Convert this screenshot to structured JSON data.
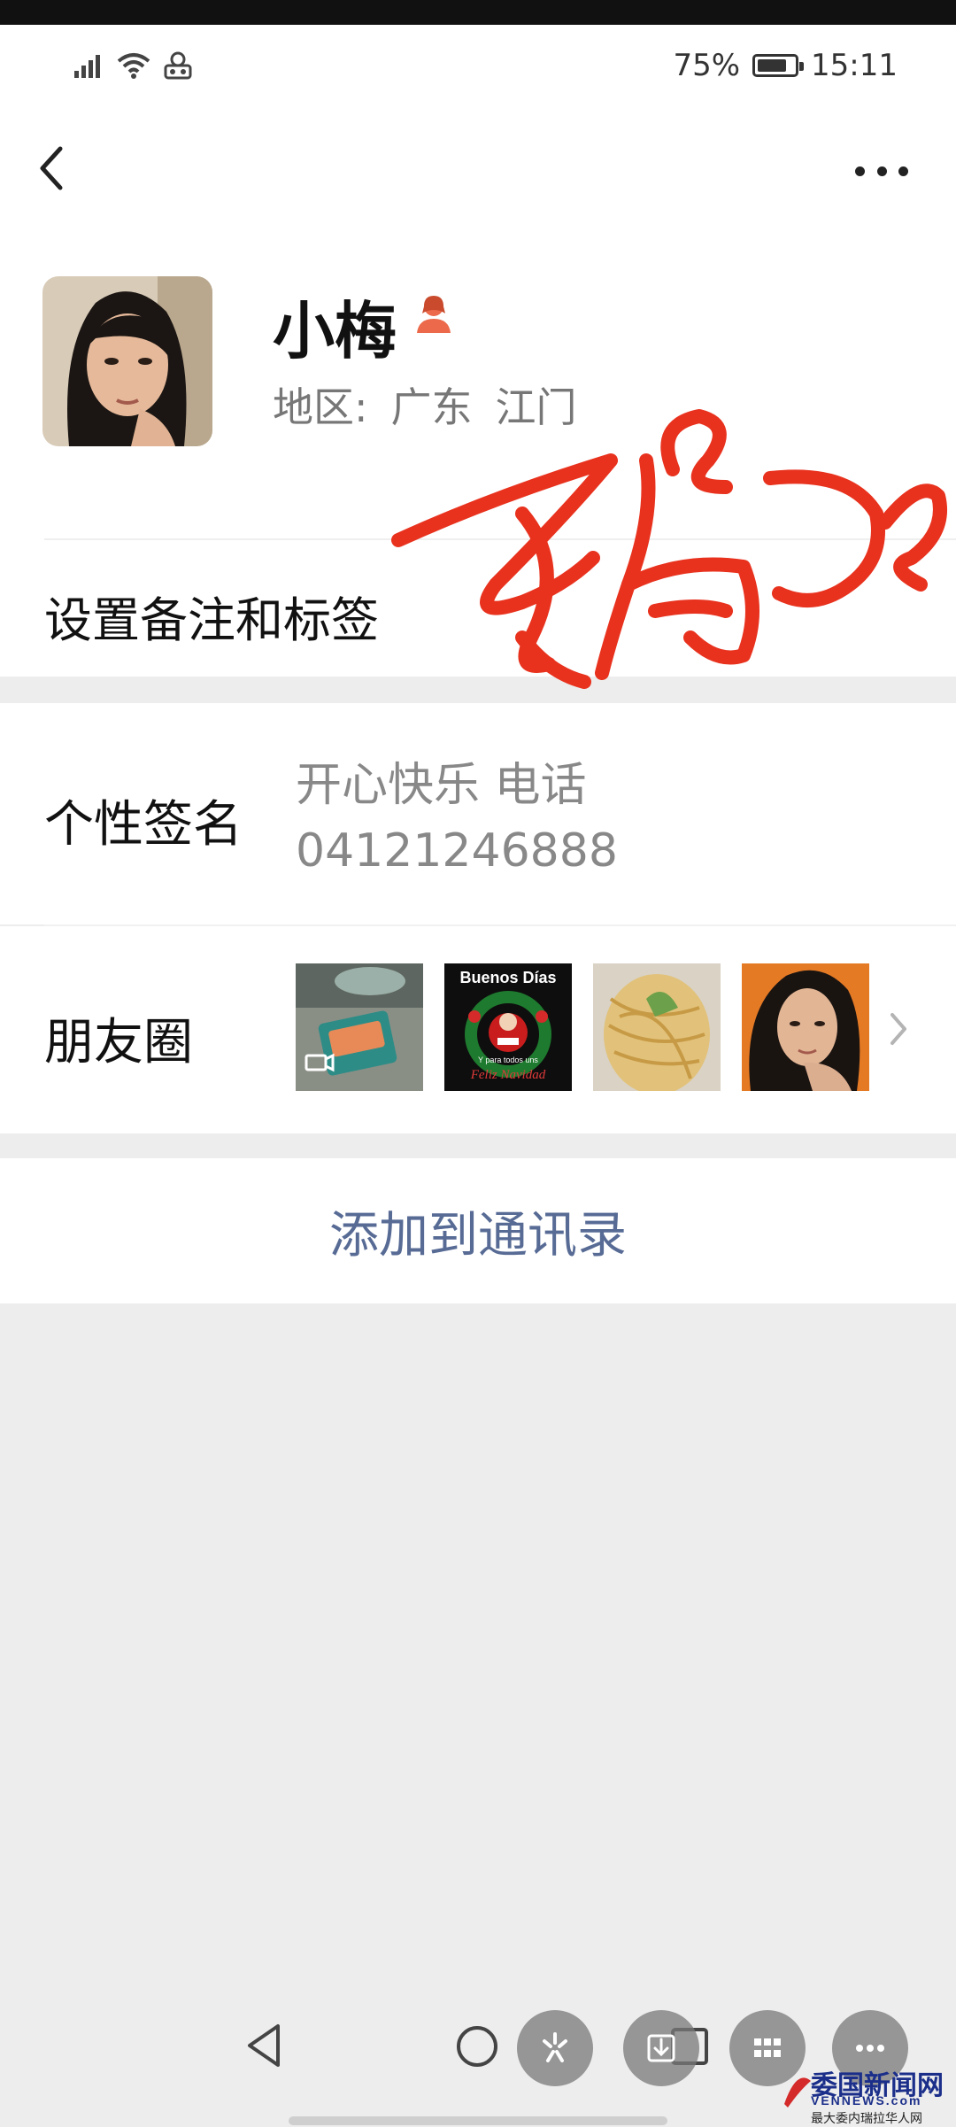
{
  "status_bar": {
    "battery_text": "75%",
    "battery_level": 0.75,
    "time": "15:11",
    "icons": [
      "signal-icon",
      "wifi-icon",
      "privacy-icon"
    ]
  },
  "header": {
    "back_icon": "chevron-left-icon",
    "more_icon": "more-dots-icon"
  },
  "profile": {
    "name": "小梅",
    "gender_icon": "female-badge-icon",
    "region_label": "地区:",
    "region_province": "广东",
    "region_city": "江门"
  },
  "rows": {
    "set_remark_label": "设置备注和标签",
    "signature_label": "个性签名",
    "signature_line1": "开心快乐 电话",
    "signature_line2": "04121246888",
    "moments_label": "朋友圈",
    "add_contact": "添加到通讯录"
  },
  "moments_thumbs": [
    {
      "name": "video-thumb",
      "caption": ""
    },
    {
      "name": "christmas-card-thumb",
      "caption_top": "Buenos Días",
      "caption_mid": "Y para todos uns",
      "caption_bottom": "Feliz Navidad"
    },
    {
      "name": "noodles-thumb",
      "caption": ""
    },
    {
      "name": "selfie-thumb",
      "caption": ""
    }
  ],
  "watermark": {
    "brand": "委国新闻网",
    "domain": "VENNEWS.com",
    "tagline": "最大委内瑞拉华人网"
  },
  "colors": {
    "link_blue": "#576b95",
    "signature_red": "#e8321e",
    "badge_orange": "#ec6a4b",
    "background_gray": "#ededed"
  }
}
